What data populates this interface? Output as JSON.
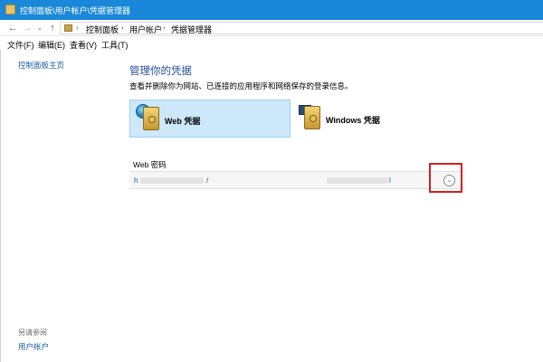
{
  "window": {
    "title": "控制面板\\用户帐户\\凭据管理器"
  },
  "nav": {
    "back": "←",
    "forward": "→",
    "recent": "⌄",
    "up": "↑"
  },
  "breadcrumb": {
    "items": [
      "控制面板",
      "用户帐户",
      "凭据管理器"
    ],
    "separator": "›"
  },
  "menu": {
    "items": [
      "文件(F)",
      "编辑(E)",
      "查看(V)",
      "工具(T)"
    ]
  },
  "left_pane": {
    "home_link": "控制面板主页",
    "see_also": "另请参阅",
    "user_accounts_link": "用户帐户"
  },
  "main": {
    "heading": "管理你的凭据",
    "subtitle": "查看并删除你为网站、已连接的应用程序和网络保存的登录信息。",
    "tabs": [
      {
        "label": "Web 凭据",
        "selected": true,
        "icon": "web-credentials-icon"
      },
      {
        "label": "Windows 凭据",
        "selected": false,
        "icon": "windows-credentials-icon"
      }
    ],
    "section_title": "Web 密码",
    "credential": {
      "url_start": "h",
      "url_end": "/",
      "user_end": "l",
      "expand_icon": "chevron-down-circle-icon"
    }
  },
  "colors": {
    "titlebar": "#1a88d8",
    "link": "#1c5ea8",
    "heading": "#1f4e99",
    "selected_tab": "#cde8fb",
    "highlight": "#d62020"
  }
}
